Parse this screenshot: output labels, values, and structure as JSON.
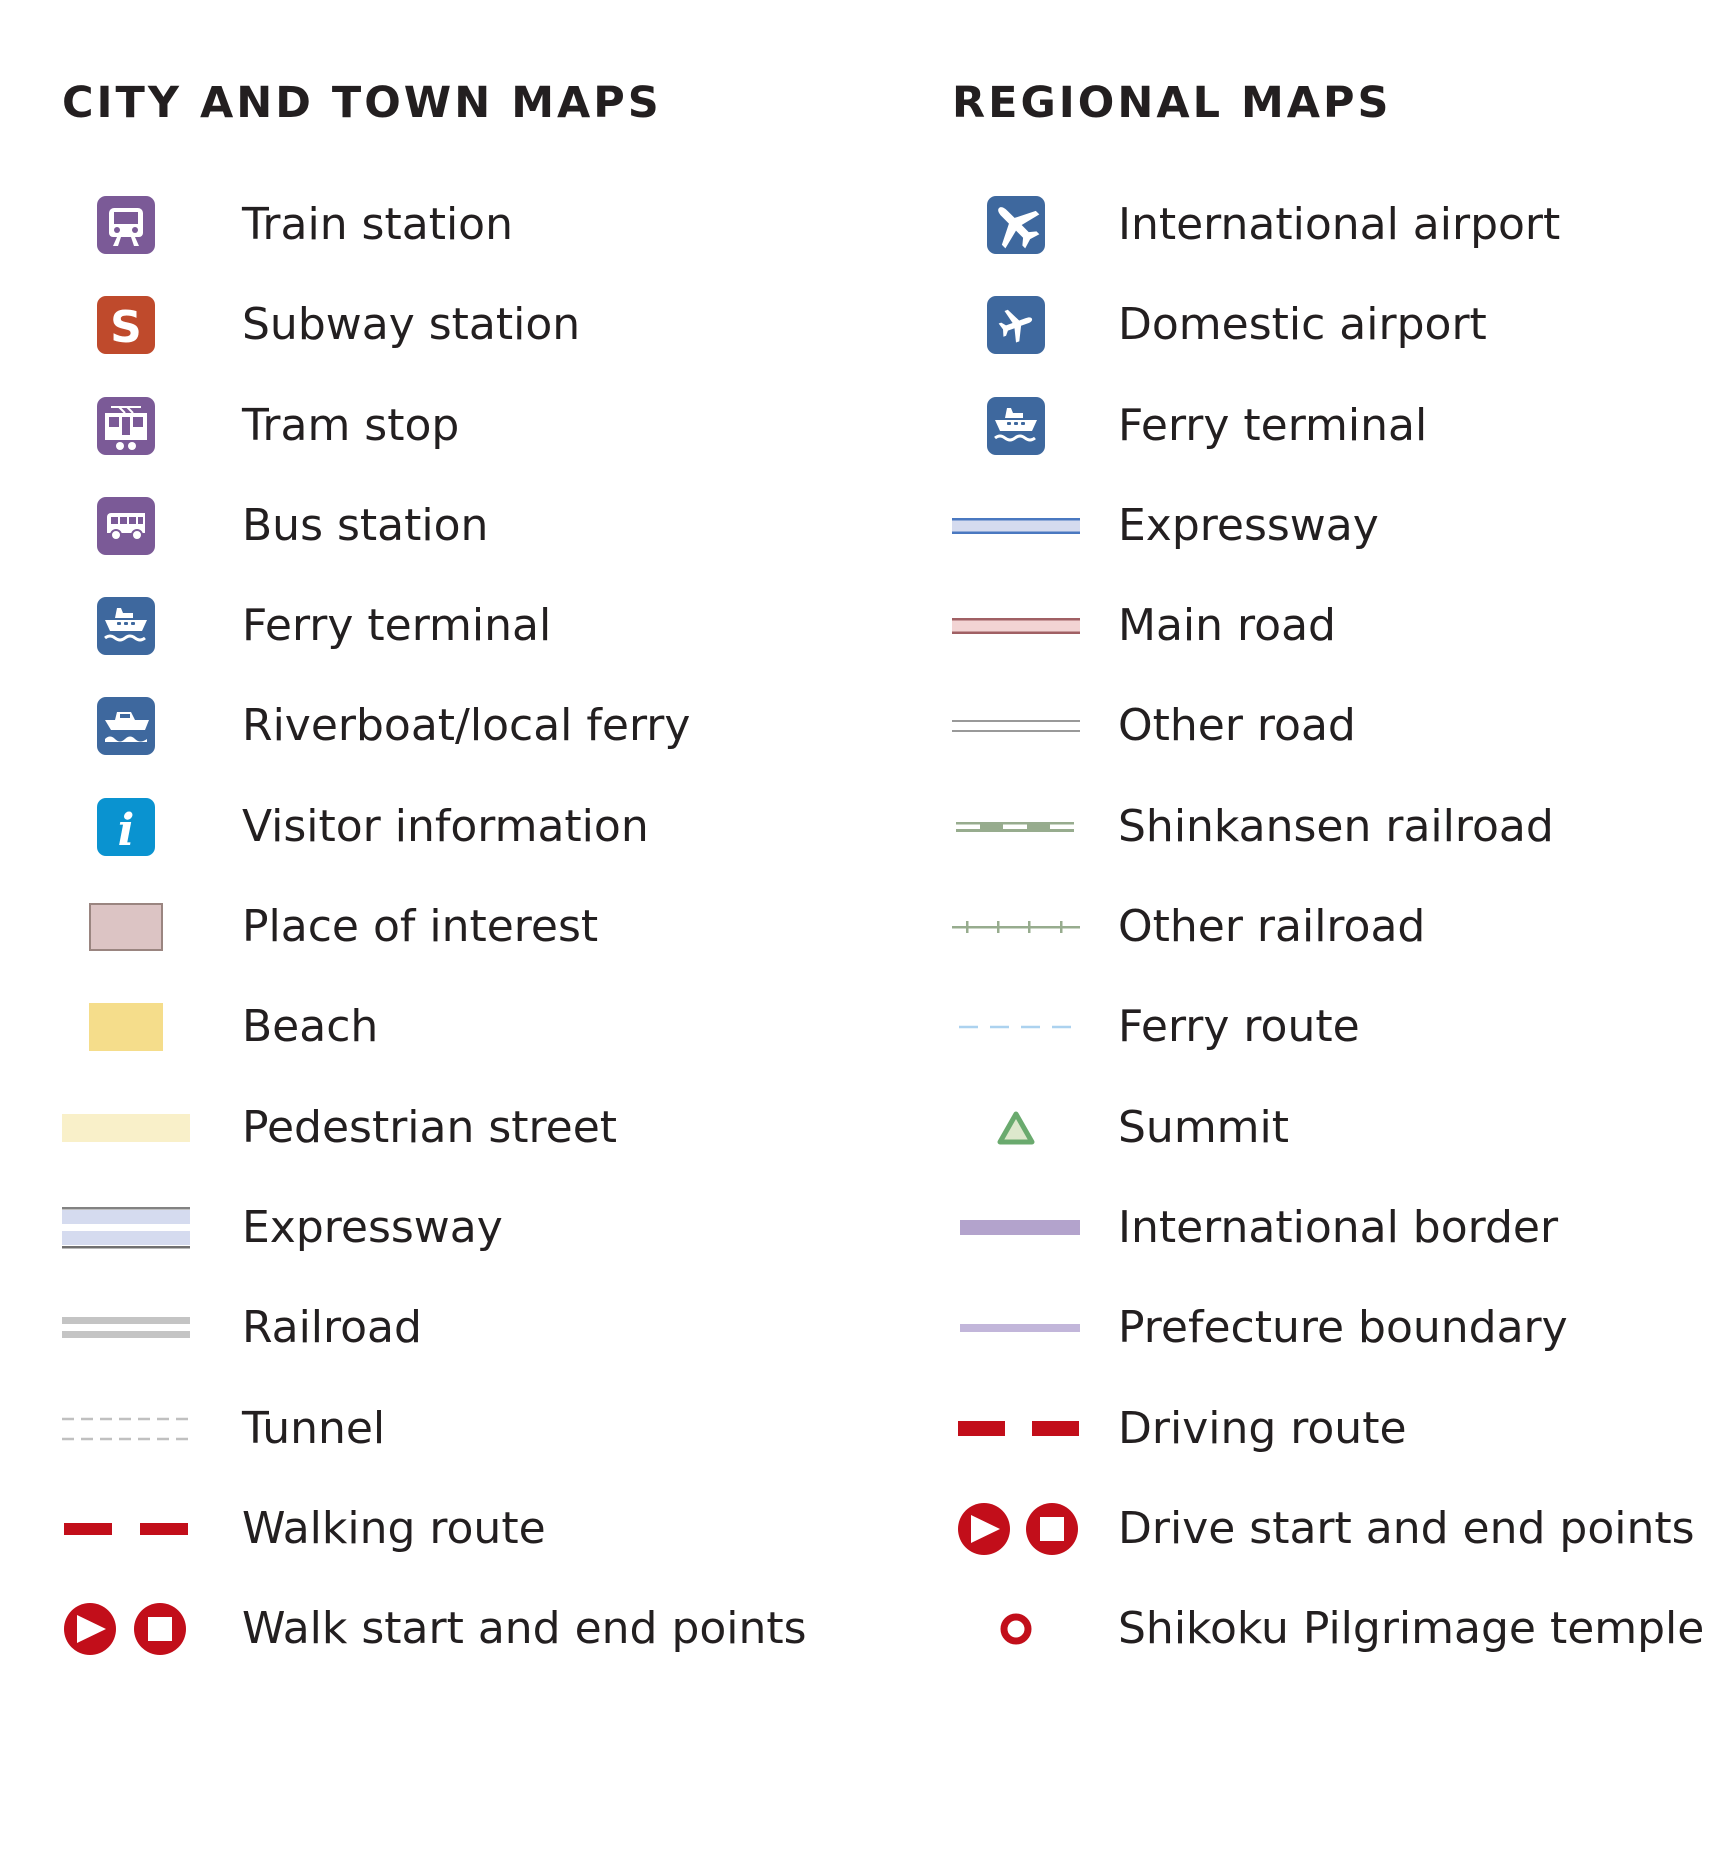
{
  "city": {
    "heading": "CITY AND TOWN MAPS",
    "items": [
      {
        "label": "Train station",
        "icon": "train-icon",
        "color": "#7b5a97"
      },
      {
        "label": "Subway station",
        "icon": "subway-icon",
        "color": "#bf4a2c"
      },
      {
        "label": "Tram stop",
        "icon": "tram-icon",
        "color": "#7b5a97"
      },
      {
        "label": "Bus station",
        "icon": "bus-icon",
        "color": "#7b5a97"
      },
      {
        "label": "Ferry terminal",
        "icon": "ferry-icon",
        "color": "#3e689e"
      },
      {
        "label": "Riverboat/local ferry",
        "icon": "riverboat-icon",
        "color": "#3e689e"
      },
      {
        "label": "Visitor information",
        "icon": "info-icon",
        "color": "#0a93d0"
      },
      {
        "label": "Place of interest",
        "icon": "place-of-interest-swatch",
        "color": "#dcc4c4"
      },
      {
        "label": "Beach",
        "icon": "beach-swatch",
        "color": "#f5dd8b"
      },
      {
        "label": "Pedestrian street",
        "icon": "pedestrian-street-line",
        "color": "#f9f0c9"
      },
      {
        "label": "Expressway",
        "icon": "expressway-line",
        "color": "#d5dbef"
      },
      {
        "label": "Railroad",
        "icon": "railroad-line",
        "color": "#c4c4c4"
      },
      {
        "label": "Tunnel",
        "icon": "tunnel-line",
        "color": "#c0c0c0"
      },
      {
        "label": "Walking route",
        "icon": "walking-route-line",
        "color": "#c20e1a"
      },
      {
        "label": "Walk start and end points",
        "icon": "start-end-points-icon",
        "color": "#c20e1a"
      }
    ]
  },
  "regional": {
    "heading": "REGIONAL MAPS",
    "items": [
      {
        "label": "International airport",
        "icon": "international-airport-icon",
        "color": "#3e689e"
      },
      {
        "label": "Domestic airport",
        "icon": "domestic-airport-icon",
        "color": "#3e689e"
      },
      {
        "label": "Ferry terminal",
        "icon": "ferry-icon",
        "color": "#3e689e"
      },
      {
        "label": "Expressway",
        "icon": "expressway-line",
        "color": "#4a78c0"
      },
      {
        "label": "Main road",
        "icon": "main-road-line",
        "color": "#a06064"
      },
      {
        "label": "Other road",
        "icon": "other-road-line",
        "color": "#999999"
      },
      {
        "label": "Shinkansen railroad",
        "icon": "shinkansen-railroad-line",
        "color": "#97ac8e"
      },
      {
        "label": "Other railroad",
        "icon": "other-railroad-line",
        "color": "#97ac8e"
      },
      {
        "label": "Ferry route",
        "icon": "ferry-route-line",
        "color": "#acd2ef"
      },
      {
        "label": "Summit",
        "icon": "summit-icon",
        "color": "#6aaa6e"
      },
      {
        "label": "International border",
        "icon": "international-border-line",
        "color": "#b3a3cc"
      },
      {
        "label": "Prefecture boundary",
        "icon": "prefecture-boundary-line",
        "color": "#c2b6da"
      },
      {
        "label": "Driving route",
        "icon": "driving-route-line",
        "color": "#c20e1a"
      },
      {
        "label": "Drive start and end points",
        "icon": "start-end-points-icon",
        "color": "#c20e1a"
      },
      {
        "label": "Shikoku Pilgrimage temple",
        "icon": "temple-icon",
        "color": "#c20e1a"
      }
    ]
  }
}
